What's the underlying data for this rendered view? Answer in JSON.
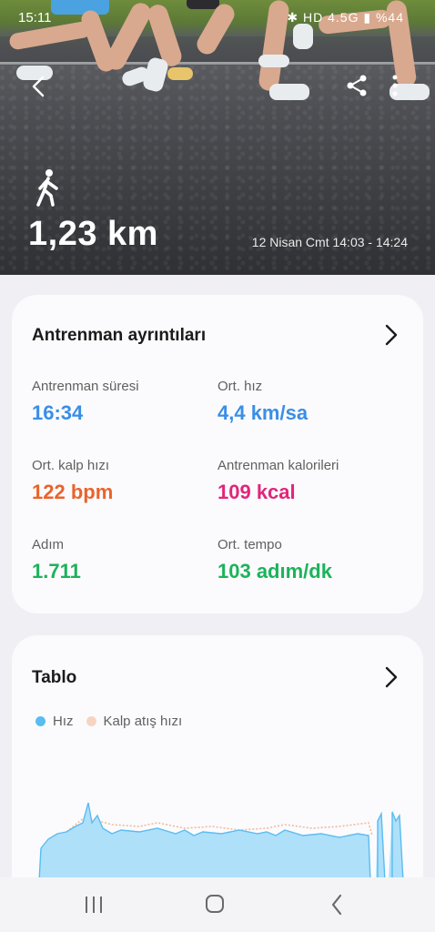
{
  "status_bar": {
    "time": "15:11",
    "battery": "%44",
    "network": "4.5G"
  },
  "workout": {
    "distance": "1,23 km",
    "date_range": "12 Nisan Cmt 14:03 - 14:24",
    "activity_icon": "walking-person-icon"
  },
  "details": {
    "title": "Antrenman ayrıntıları",
    "metrics": [
      {
        "label": "Antrenman süresi",
        "value": "16:34",
        "color": "#3a8ee6"
      },
      {
        "label": "Ort. hız",
        "value": "4,4 km/sa",
        "color": "#3a8ee6"
      },
      {
        "label": "Ort. kalp hızı",
        "value": "122 bpm",
        "color": "#e8642c"
      },
      {
        "label": "Antrenman kalorileri",
        "value": "109 kcal",
        "color": "#e0267a"
      },
      {
        "label": "Adım",
        "value": "1.711",
        "color": "#1cb35a"
      },
      {
        "label": "Ort. tempo",
        "value": "103 adım/dk",
        "color": "#1cb35a"
      }
    ]
  },
  "chart_card": {
    "title": "Tablo",
    "legend": [
      {
        "name": "Hız",
        "color": "#5bbcf0"
      },
      {
        "name": "Kalp atış hızı",
        "color": "#f7d4c2"
      }
    ]
  },
  "colors": {
    "accent_blue": "#3a8ee6",
    "heart_orange": "#e8642c",
    "calorie_pink": "#e0267a",
    "step_green": "#1cb35a"
  }
}
